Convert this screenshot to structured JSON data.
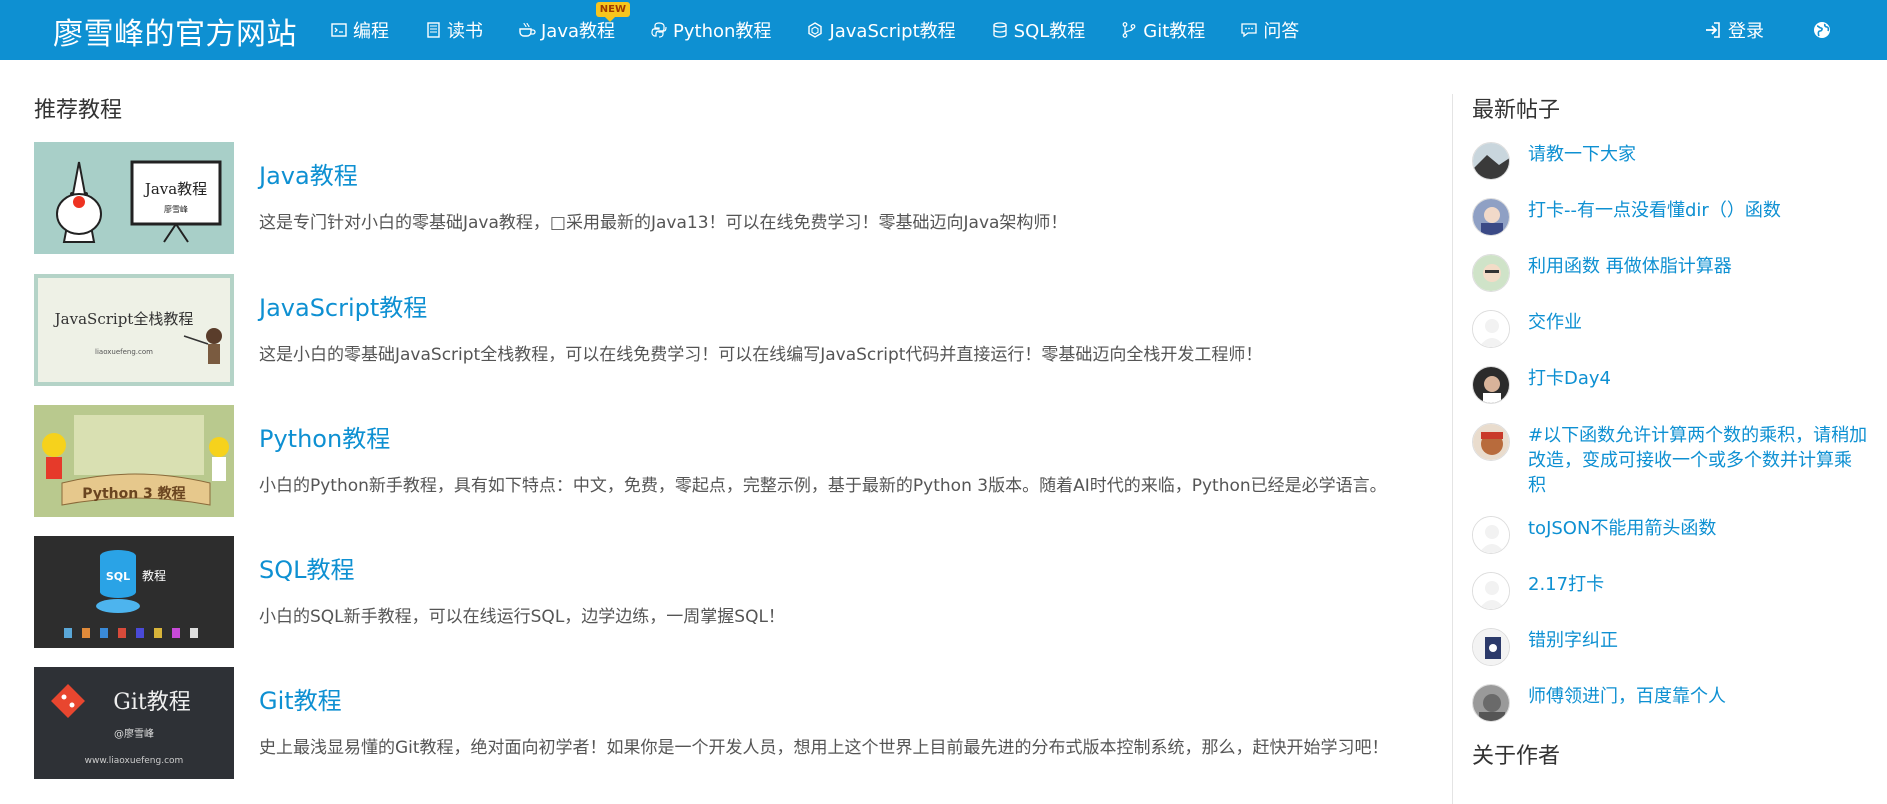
{
  "site": {
    "brand": "廖雪峰的官方网站"
  },
  "nav": {
    "items": [
      {
        "label": "编程",
        "icon": "code-icon"
      },
      {
        "label": "读书",
        "icon": "book-icon"
      },
      {
        "label": "Java教程",
        "icon": "coffee-icon",
        "badge": "NEW"
      },
      {
        "label": "Python教程",
        "icon": "python-icon"
      },
      {
        "label": "JavaScript教程",
        "icon": "hexagon-icon"
      },
      {
        "label": "SQL教程",
        "icon": "database-icon"
      },
      {
        "label": "Git教程",
        "icon": "git-branch-icon"
      },
      {
        "label": "问答",
        "icon": "chat-icon"
      }
    ],
    "login": "登录",
    "globe_icon": "globe-icon"
  },
  "recommended": {
    "title": "推荐教程",
    "tutorials": [
      {
        "title": "Java教程",
        "desc": "这是专门针对小白的零基础Java教程，□采用最新的Java13！可以在线免费学习！零基础迈向Java架构师！",
        "thumb_text": "Java教程",
        "thumb_sub": "廖雪峰"
      },
      {
        "title": "JavaScript教程",
        "desc": "这是小白的零基础JavaScript全栈教程，可以在线免费学习！可以在线编写JavaScript代码并直接运行！零基础迈向全栈开发工程师！",
        "thumb_text": "JavaScript全栈教程",
        "thumb_sub": "liaoxuefeng.com"
      },
      {
        "title": "Python教程",
        "desc": "小白的Python新手教程，具有如下特点：中文，免费，零起点，完整示例，基于最新的Python 3版本。随着AI时代的来临，Python已经是必学语言。",
        "thumb_text": "Python 3 教程"
      },
      {
        "title": "SQL教程",
        "desc": "小白的SQL新手教程，可以在线运行SQL，边学边练，一周掌握SQL！",
        "thumb_text": "教程",
        "thumb_sub": "SQL"
      },
      {
        "title": "Git教程",
        "desc": "史上最浅显易懂的Git教程，绝对面向初学者！如果你是一个开发人员，想用上这个世界上目前最先进的分布式版本控制系统，那么，赶快开始学习吧！",
        "thumb_text": "Git教程",
        "thumb_sub": "@廖雪峰",
        "thumb_url": "www.liaoxuefeng.com"
      }
    ]
  },
  "sidebar": {
    "latest_title": "最新帖子",
    "about_title": "关于作者",
    "posts": [
      {
        "title": "请教一下大家"
      },
      {
        "title": "打卡--有一点没看懂dir（）函数"
      },
      {
        "title": "利用函数 再做体脂计算器"
      },
      {
        "title": "交作业"
      },
      {
        "title": "打卡Day4"
      },
      {
        "title": "#以下函数允许计算两个数的乘积，请稍加改造，变成可接收一个或多个数并计算乘积"
      },
      {
        "title": "toJSON不能用箭头函数"
      },
      {
        "title": "2.17打卡"
      },
      {
        "title": "错别字纠正"
      },
      {
        "title": "师傅领进门，百度靠个人"
      }
    ]
  },
  "colors": {
    "brand_blue": "#0e90d2",
    "link": "#0e90d2",
    "text": "#333333",
    "muted": "#555555"
  }
}
